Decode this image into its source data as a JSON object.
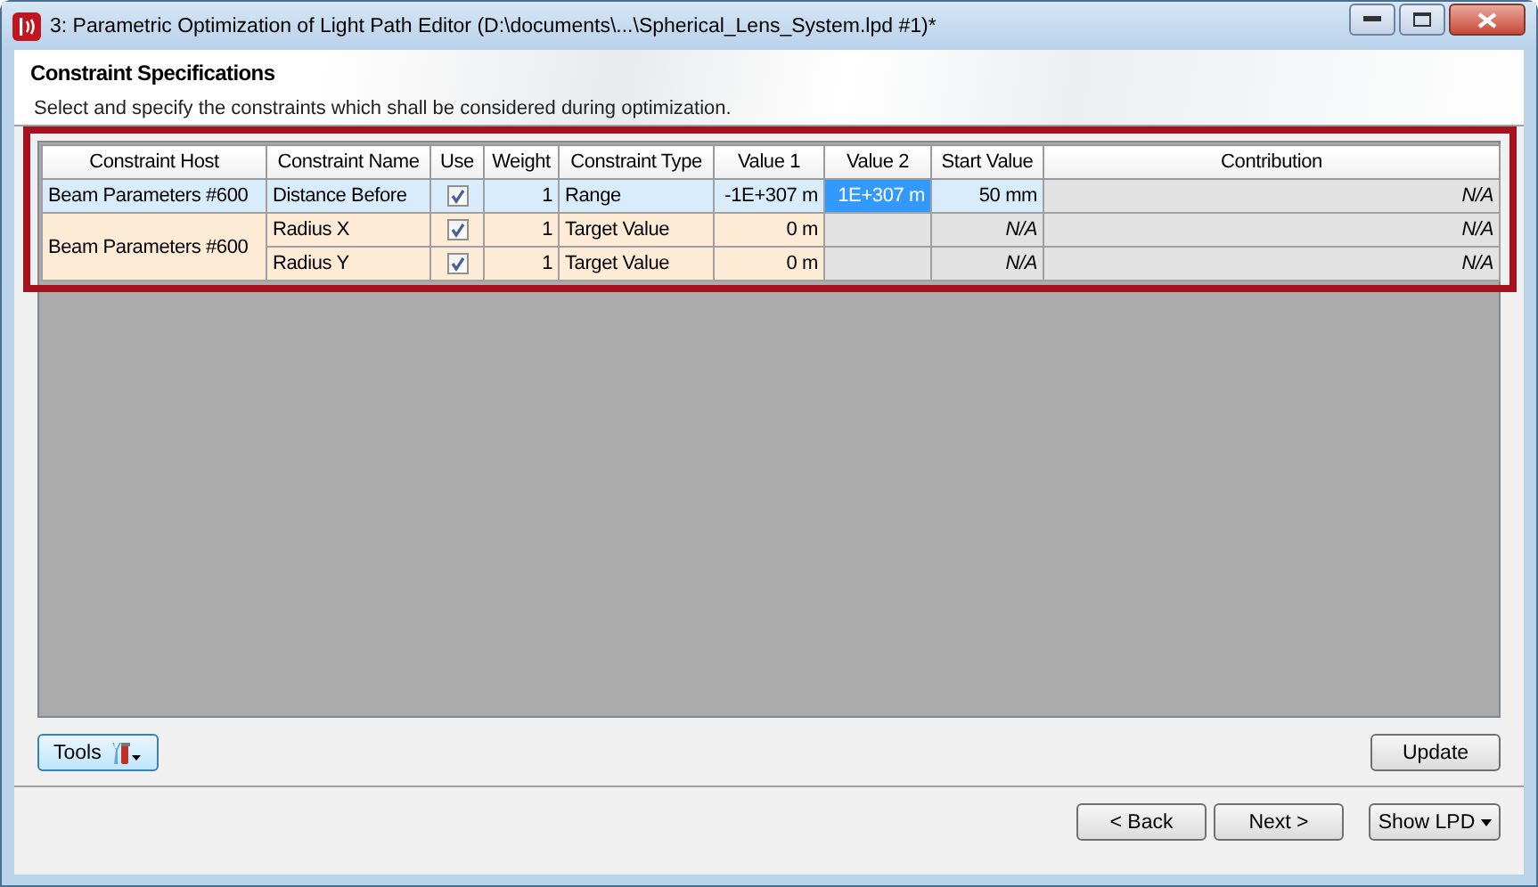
{
  "window": {
    "title": "3: Parametric Optimization of Light Path Editor (D:\\documents\\...\\Spherical_Lens_System.lpd #1)*"
  },
  "header": {
    "title": "Constraint Specifications",
    "description": "Select and specify the constraints which shall be considered during optimization."
  },
  "table": {
    "columns": [
      "Constraint Host",
      "Constraint Name",
      "Use",
      "Weight",
      "Constraint Type",
      "Value 1",
      "Value 2",
      "Start Value",
      "Contribution"
    ],
    "groups": [
      {
        "host": "Beam Parameters #600",
        "selected": true,
        "constraints": [
          {
            "name": "Distance Before",
            "use": true,
            "weight": "1",
            "type": "Range",
            "value_1": "-1E+307 m",
            "value_2": "1E+307 m",
            "value_2_focused": true,
            "start_value": "50 mm",
            "contribution": "N/A"
          }
        ]
      },
      {
        "host": "Beam Parameters #600",
        "selected": false,
        "constraints": [
          {
            "name": "Radius X",
            "use": true,
            "weight": "1",
            "type": "Target Value",
            "value_1": "0 m",
            "value_2_focused": false,
            "start_value": "N/A",
            "contribution": "N/A"
          },
          {
            "name": "Radius Y",
            "use": true,
            "weight": "1",
            "type": "Target Value",
            "value_1": "0 m",
            "value_2_focused": false,
            "start_value": "N/A",
            "contribution": "N/A"
          }
        ]
      }
    ]
  },
  "buttons": {
    "tools": "Tools",
    "update": "Update",
    "back": "< Back",
    "next": "Next >",
    "show_lpd": "Show LPD"
  }
}
